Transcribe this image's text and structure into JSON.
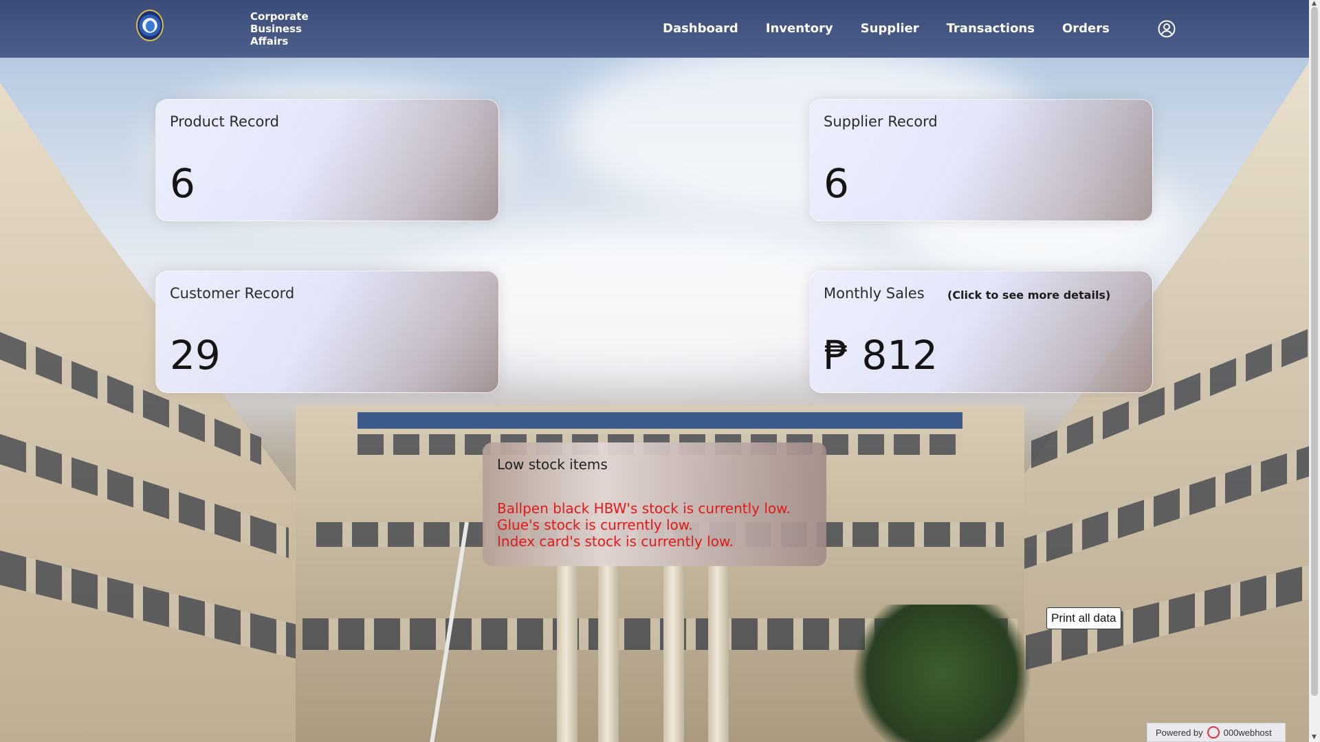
{
  "brand": {
    "line1": "Corporate",
    "line2": "Business",
    "line3": "Affairs"
  },
  "nav": {
    "items": [
      {
        "label": "Dashboard"
      },
      {
        "label": "Inventory"
      },
      {
        "label": "Supplier"
      },
      {
        "label": "Transactions"
      },
      {
        "label": "Orders"
      }
    ]
  },
  "cards": {
    "product": {
      "title": "Product Record",
      "value": "6"
    },
    "supplier": {
      "title": "Supplier Record",
      "value": "6"
    },
    "customer": {
      "title": "Customer Record",
      "value": "29"
    },
    "sales": {
      "title": "Monthly Sales",
      "hint": "(Click to see more details)",
      "value": "₱ 812"
    }
  },
  "low_stock": {
    "title": "Low stock items",
    "items": [
      "Ballpen black HBW's stock is currently low.",
      "Glue's stock is currently low.",
      "Index card's stock is currently low."
    ]
  },
  "actions": {
    "print_label": "Print all data"
  },
  "footer": {
    "powered_label": "Powered by",
    "host_name": "000webhost"
  },
  "colors": {
    "nav_bg": "#465684",
    "alert_text": "#e21a1a"
  },
  "icons": {
    "user": "user-circle-icon",
    "logo": "school-seal-logo"
  }
}
